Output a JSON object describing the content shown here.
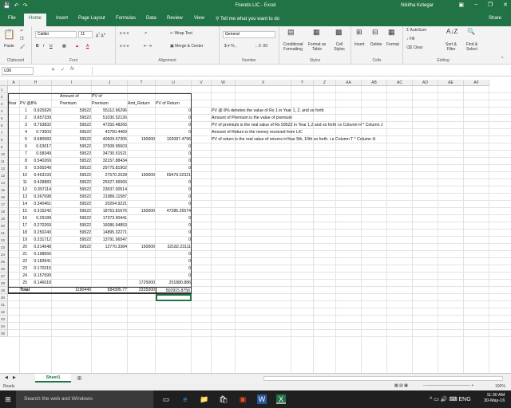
{
  "window": {
    "title": "Friends LIC - Excel",
    "user": "Nikitha Kotegar",
    "share": "Share"
  },
  "tabs": [
    "File",
    "Home",
    "Insert",
    "Page Layout",
    "Formulas",
    "Data",
    "Review",
    "View"
  ],
  "tellme": "Tell me what you want to do",
  "ribbon": {
    "paste": "Paste",
    "font_name": "Calibri",
    "font_size": "11",
    "wrap_text": "Wrap Text",
    "merge_center": "Merge & Center",
    "number_format": "General",
    "cond_format": "Conditional Formatting",
    "format_table": "Format as Table",
    "cell_styles": "Cell Styles",
    "insert": "Insert",
    "delete": "Delete",
    "format": "Format",
    "autosum": "AutoSum",
    "fill": "Fill",
    "clear": "Clear",
    "sort_filter": "Sort & Filter",
    "find_select": "Find & Select",
    "groups": [
      "Clipboard",
      "Font",
      "Alignment",
      "Number",
      "Styles",
      "Cells",
      "Editing"
    ]
  },
  "formula_bar": {
    "name_box": "U30",
    "fx": "fx",
    "content": ""
  },
  "columns": [
    "A",
    "H",
    "I",
    "J",
    "T",
    "U",
    "V",
    "W",
    "X",
    "Y",
    "Z",
    "AA",
    "AB",
    "AC",
    "AD",
    "AE",
    "AF"
  ],
  "rows": [
    "1",
    "2",
    "3",
    "4",
    "5",
    "6",
    "7",
    "8",
    "9",
    "10",
    "11",
    "12",
    "13",
    "14",
    "15",
    "16",
    "17",
    "18",
    "19",
    "20",
    "21",
    "22",
    "23",
    "24",
    "25",
    "26",
    "27",
    "28",
    "29",
    "30",
    "31",
    "32",
    "33",
    "34",
    "35"
  ],
  "headers": {
    "year": "Year",
    "pv8_top": "",
    "pv8": "PV @8%",
    "amt_prem_top": "Amount of",
    "amt_prem": "Premium",
    "pv_prem_top": "PV of",
    "pv_prem": "Premium",
    "amt_return": "Amt_Return",
    "pv_return": "PV of Return"
  },
  "table": [
    [
      "1",
      "0.925926",
      "59522",
      "55112.96296",
      "",
      "0"
    ],
    [
      "2",
      "0.857339",
      "59522",
      "51030.52126",
      "",
      "0"
    ],
    [
      "3",
      "0.793832",
      "59522",
      "47250.48265",
      "",
      "0"
    ],
    [
      "4",
      "0.73503",
      "59522",
      "43750.4469",
      "",
      "0"
    ],
    [
      "5",
      "0.680583",
      "59522",
      "40509.67305",
      "150000",
      "102087.4796"
    ],
    [
      "6",
      "0.63017",
      "59522",
      "37508.95603",
      "",
      "0"
    ],
    [
      "7",
      "0.58349",
      "59522",
      "34730.51521",
      "",
      "0"
    ],
    [
      "8",
      "0.540269",
      "59522",
      "32157.88434",
      "",
      "0"
    ],
    [
      "9",
      "0.500249",
      "59522",
      "29775.81902",
      "",
      "0"
    ],
    [
      "10",
      "0.463193",
      "59522",
      "27570.2028",
      "150000",
      "69479.02321"
    ],
    [
      "11",
      "0.428883",
      "59522",
      "25527.96565",
      "",
      "0"
    ],
    [
      "12",
      "0.397114",
      "59522",
      "23637.00514",
      "",
      "0"
    ],
    [
      "13",
      "0.367698",
      "59522",
      "21886.11587",
      "",
      "0"
    ],
    [
      "14",
      "0.340461",
      "59522",
      "20264.9221",
      "",
      "0"
    ],
    [
      "15",
      "0.315242",
      "59522",
      "18763.81676",
      "150000",
      "47286.25574"
    ],
    [
      "16",
      "0.29189",
      "59522",
      "17373.90441",
      "",
      "0"
    ],
    [
      "17",
      "0.270269",
      "59522",
      "16086.94853",
      "",
      "0"
    ],
    [
      "18",
      "0.250249",
      "59522",
      "14895.32271",
      "",
      "0"
    ],
    [
      "19",
      "0.231712",
      "59522",
      "13791.96547",
      "",
      "0"
    ],
    [
      "20",
      "0.214548",
      "59522",
      "12770.3384",
      "150000",
      "32182.23111"
    ],
    [
      "21",
      "0.198656",
      "",
      "",
      "",
      "0"
    ],
    [
      "22",
      "0.183941",
      "",
      "",
      "",
      "0"
    ],
    [
      "23",
      "0.170315",
      "",
      "",
      "",
      "0"
    ],
    [
      "24",
      "0.157699",
      "",
      "",
      "",
      "0"
    ],
    [
      "25",
      "0.146018",
      "",
      "",
      "1725000",
      "251880.886"
    ]
  ],
  "total": {
    "label": "Total",
    "premium": "1190440",
    "pv_premium": "584395.77",
    "amt_return": "2325000",
    "pv_return": "502915.8756"
  },
  "notes": [
    "PV @ 8% denotes the value of Rs 1 in Year 1, 2, and so forth",
    "Amount of Premium is the value of premium",
    "PV of premium is the real value of Rs 59522 in Year 1,2 and so forth i.e Column H * Column J",
    "Amount of Return is the money received from LIC",
    "PV of return is the real value of returns inYear 5th, 10th so forth. i.e Column T * Column H"
  ],
  "sheet_tab": "Sheet1",
  "status": {
    "ready": "Ready",
    "zoom": "100%"
  },
  "taskbar": {
    "search": "Search the web and Windows",
    "time": "11:30 AM",
    "date": "30-May-16"
  }
}
